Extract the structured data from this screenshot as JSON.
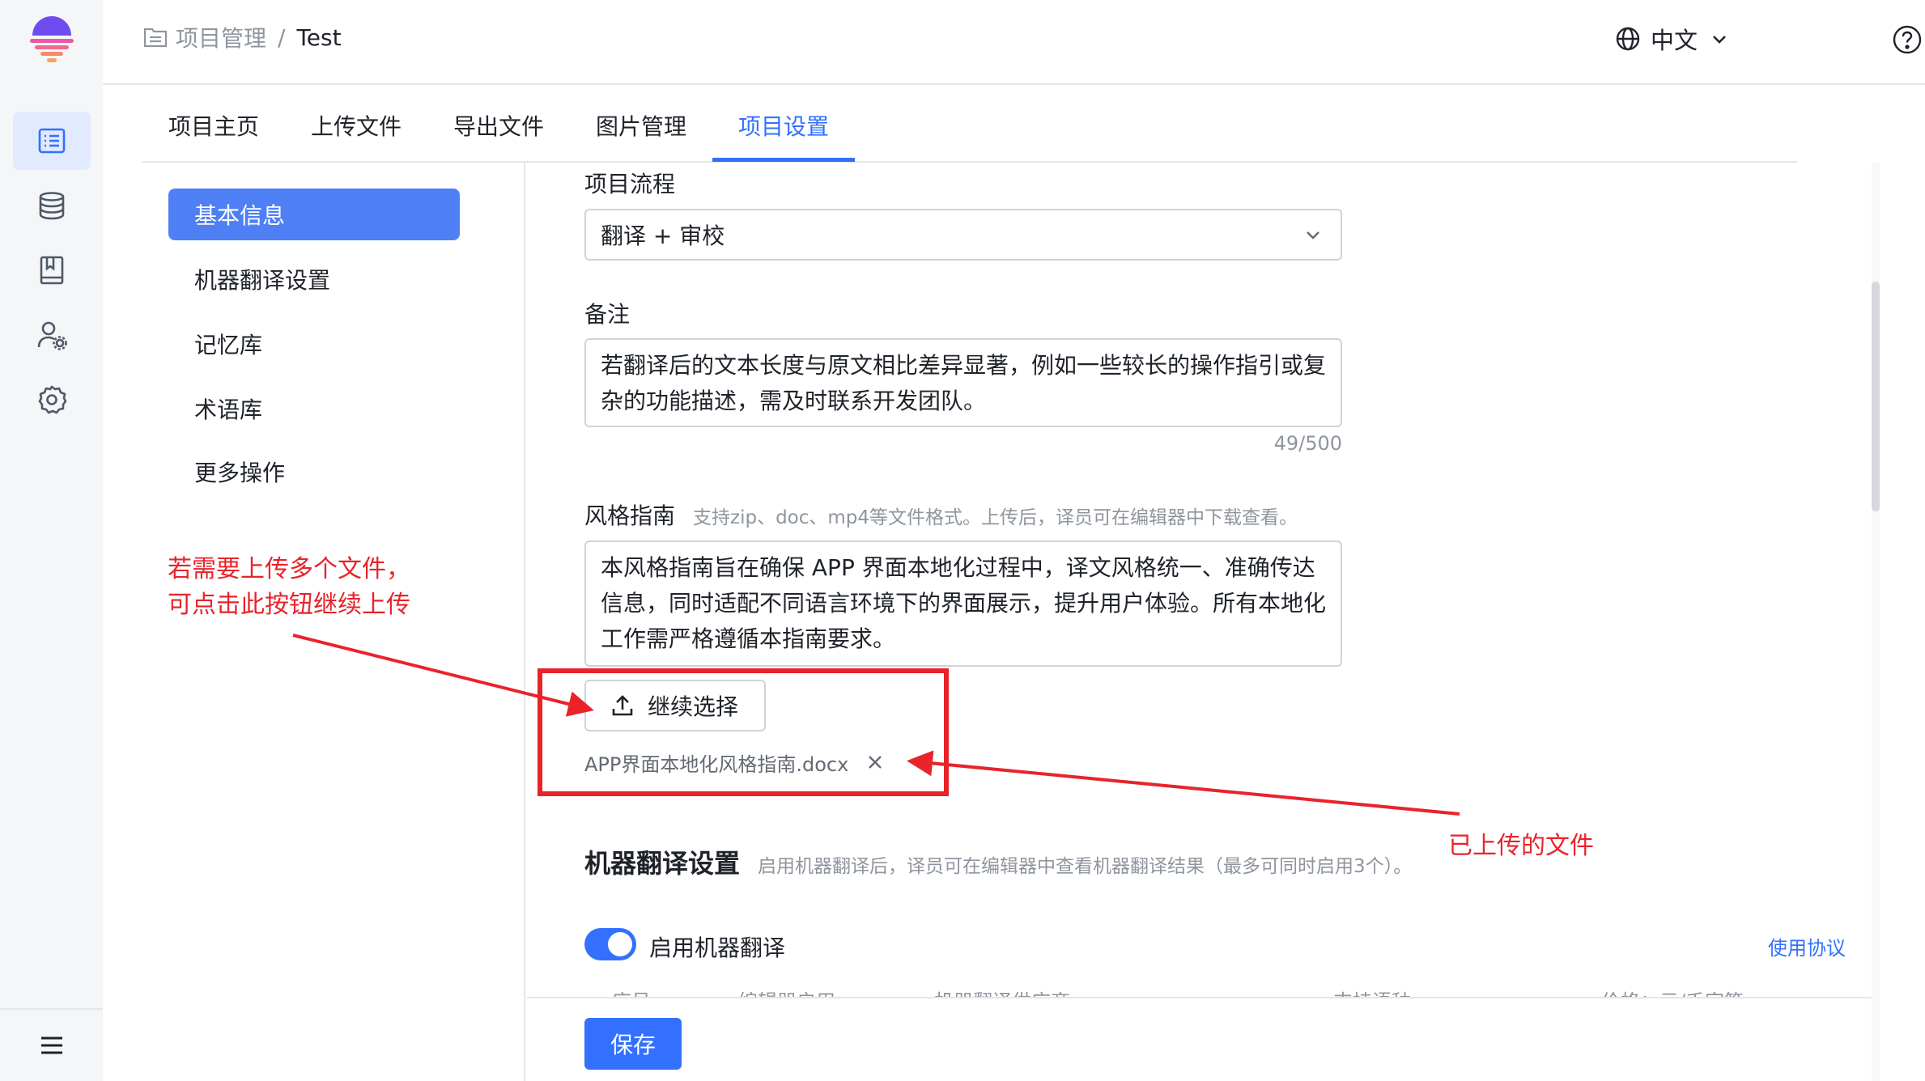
{
  "colors": {
    "accent": "#3370ff",
    "annotation": "#e8232a",
    "nav_active": "#4f7ff5"
  },
  "rail": {
    "logo_icon": "brand-logo-icon",
    "items": [
      {
        "icon": "project-list-icon",
        "active": true
      },
      {
        "icon": "database-icon",
        "active": false
      },
      {
        "icon": "book-icon",
        "active": false
      },
      {
        "icon": "user-settings-icon",
        "active": false
      },
      {
        "icon": "gear-icon",
        "active": false
      }
    ],
    "menu_icon": "hamburger-menu-icon"
  },
  "header": {
    "breadcrumb_root": "项目管理",
    "breadcrumb_sep": "/",
    "breadcrumb_current": "Test",
    "language": "中文"
  },
  "tabs": [
    "项目主页",
    "上传文件",
    "导出文件",
    "图片管理",
    "项目设置"
  ],
  "active_tab": "项目设置",
  "side_nav": [
    "基本信息",
    "机器翻译设置",
    "记忆库",
    "术语库",
    "更多操作"
  ],
  "form": {
    "workflow_label": "项目流程",
    "workflow_value": "翻译 + 审校",
    "note_label": "备注",
    "note_value": "若翻译后的文本长度与原文相比差异显著，例如一些较长的操作指引或复杂的功能描述，需及时联系开发团队。",
    "note_count": "49/500",
    "style_label": "风格指南",
    "style_hint": "支持zip、doc、mp4等文件格式。上传后，译员可在编辑器中下载查看。",
    "style_value": "本风格指南旨在确保 APP 界面本地化过程中，译文风格统一、准确传达信息，同时适配不同语言环境下的界面展示，提升用户体验。所有本地化工作需严格遵循本指南要求。",
    "upload_button": "继续选择",
    "uploaded_file": "APP界面本地化风格指南.docx"
  },
  "mt": {
    "title": "机器翻译设置",
    "hint": "启用机器翻译后，译员可在编辑器中查看机器翻译结果（最多可同时启用3个）。",
    "toggle_label": "启用机器翻译",
    "toggle_on": true,
    "terms_link": "使用协议",
    "table_headers": [
      "序号",
      "编辑器启用",
      "机器翻译供应商",
      "支持语种",
      "价格：元/千字符"
    ]
  },
  "footer": {
    "save": "保存"
  },
  "annotations": {
    "upload_hint": "若需要上传多个文件，\n可点击此按钮继续上传",
    "uploaded_label": "已上传的文件"
  }
}
